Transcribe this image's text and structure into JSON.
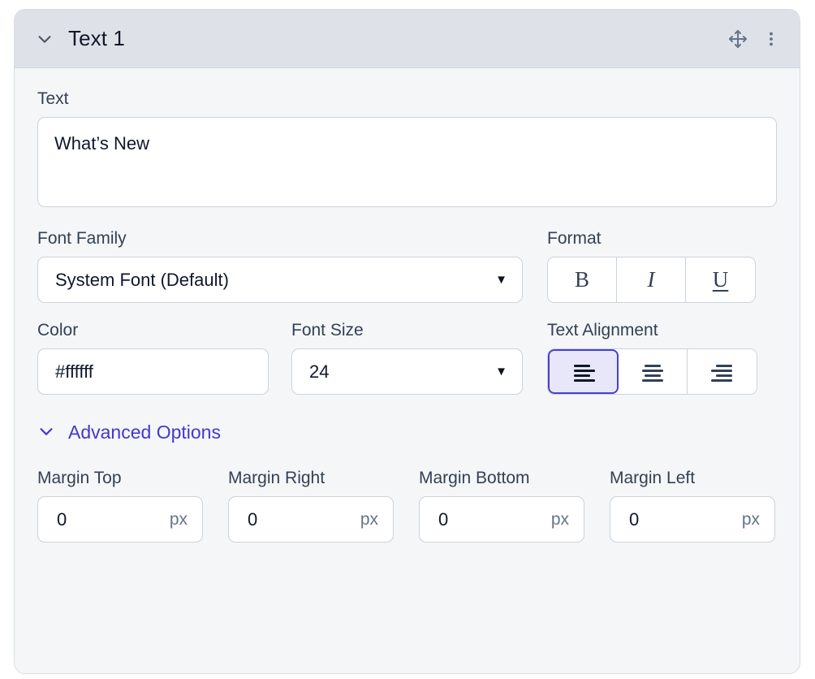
{
  "panel": {
    "title": "Text 1",
    "collapse_icon": "chevron-down-icon",
    "move_icon": "move-icon",
    "menu_icon": "more-vertical-icon"
  },
  "fields": {
    "text": {
      "label": "Text",
      "value": "What’s New",
      "placeholder": ""
    },
    "font_family": {
      "label": "Font Family",
      "value": "System Font (Default)",
      "caret": "▼",
      "options": [
        "System Font (Default)"
      ]
    },
    "format": {
      "label": "Format",
      "buttons": [
        {
          "name": "bold",
          "glyph": "B",
          "active": false
        },
        {
          "name": "italic",
          "glyph": "I",
          "active": false
        },
        {
          "name": "underline",
          "glyph": "U",
          "active": false
        }
      ]
    },
    "color": {
      "label": "Color",
      "value": "#ffffff",
      "swatch": "#ffffff"
    },
    "font_size": {
      "label": "Font Size",
      "value": "24",
      "caret": "▼",
      "options": [
        "24"
      ]
    },
    "text_alignment": {
      "label": "Text Alignment",
      "buttons": [
        {
          "name": "align-left",
          "active": true
        },
        {
          "name": "align-center",
          "active": false
        },
        {
          "name": "align-right",
          "active": false
        }
      ],
      "active_bg": "#e7e7f9",
      "active_border": "#4a3fd0"
    },
    "advanced": {
      "label": "Advanced Options",
      "color": "#4338ca",
      "icon": "chevron-down-icon"
    },
    "margins": [
      {
        "label": "Margin Top",
        "value": "0",
        "unit": "px"
      },
      {
        "label": "Margin Right",
        "value": "0",
        "unit": "px"
      },
      {
        "label": "Margin Bottom",
        "value": "0",
        "unit": "px"
      },
      {
        "label": "Margin Left",
        "value": "0",
        "unit": "px"
      }
    ]
  }
}
